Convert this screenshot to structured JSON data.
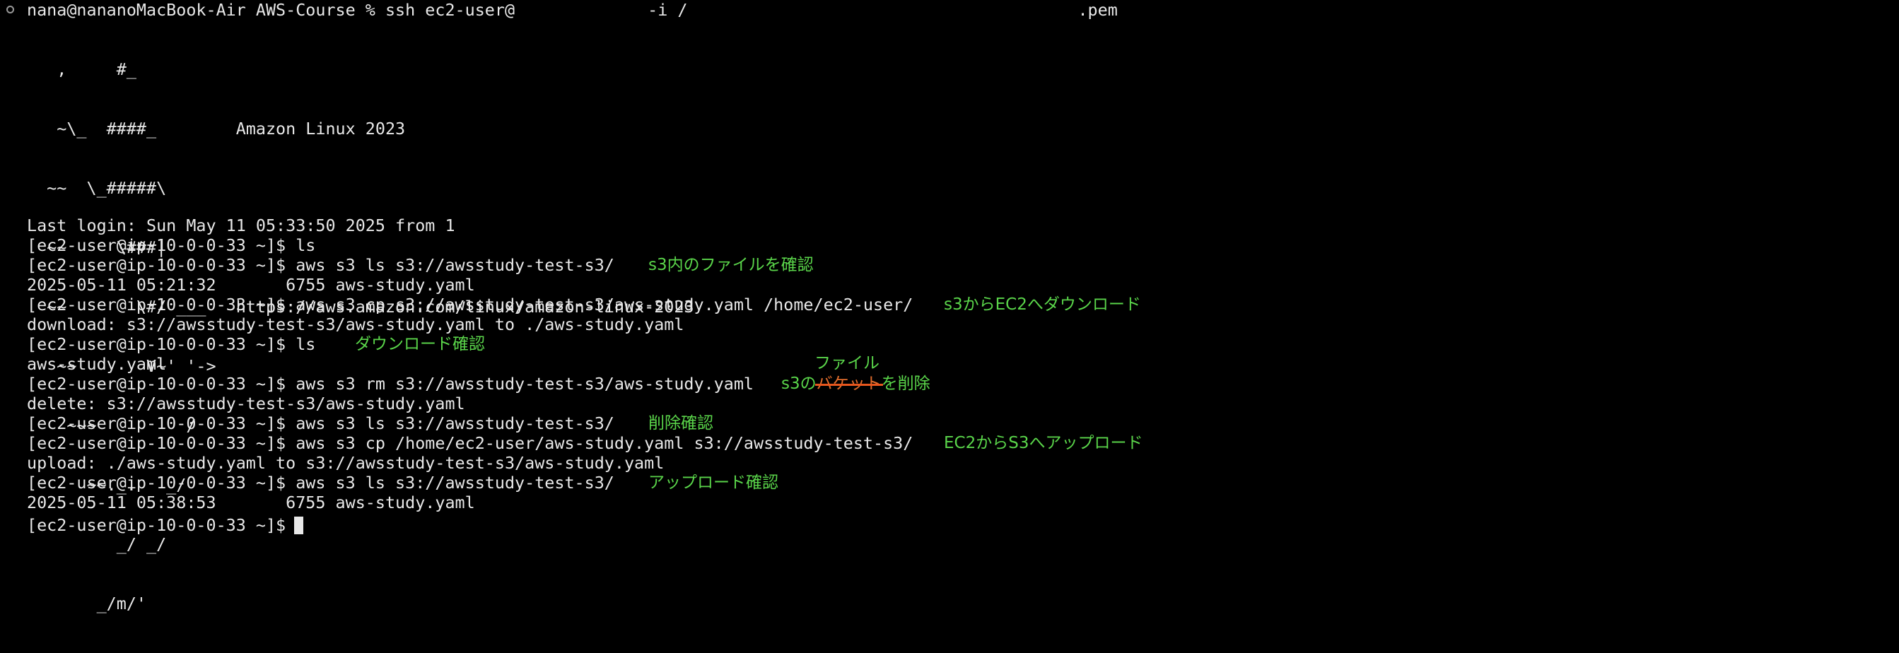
{
  "terminal": {
    "first_command": "nana@nananoMacBook-Air AWS-Course % ssh ec2-user@",
    "first_command_middle": " -i /",
    "first_command_end": ".pem",
    "banner": {
      "art_lines": [
        "   ,     #_",
        "   ~\\_  ####_        Amazon Linux 2023",
        "  ~~  \\_#####\\",
        "  ~~     \\###|",
        "  ~~       \\#/ ___   https://aws.amazon.com/linux/amazon-linux-2023",
        "   ~~       V~' '->",
        "    ~~~         /",
        "      ~~._.   _/",
        "         _/ _/",
        "       _/m/'"
      ]
    },
    "last_login": "Last login: Sun May 11 05:33:50 2025 from 1",
    "lines": [
      "[ec2-user@ip-10-0-0-33 ~]$ ls",
      "[ec2-user@ip-10-0-0-33 ~]$ aws s3 ls s3://awsstudy-test-s3/",
      "2025-05-11 05:21:32       6755 aws-study.yaml",
      "[ec2-user@ip-10-0-0-33 ~]$ aws s3 cp s3://awsstudy-test-s3/aws-study.yaml /home/ec2-user/",
      "download: s3://awsstudy-test-s3/aws-study.yaml to ./aws-study.yaml",
      "[ec2-user@ip-10-0-0-33 ~]$ ls",
      "aws-study.yaml",
      "[ec2-user@ip-10-0-0-33 ~]$ aws s3 rm s3://awsstudy-test-s3/aws-study.yaml",
      "delete: s3://awsstudy-test-s3/aws-study.yaml",
      "[ec2-user@ip-10-0-0-33 ~]$ aws s3 ls s3://awsstudy-test-s3/",
      "[ec2-user@ip-10-0-0-33 ~]$ aws s3 cp /home/ec2-user/aws-study.yaml s3://awsstudy-test-s3/",
      "upload: ./aws-study.yaml to s3://awsstudy-test-s3/aws-study.yaml",
      "[ec2-user@ip-10-0-0-33 ~]$ aws s3 ls s3://awsstudy-test-s3/",
      "2025-05-11 05:38:53       6755 aws-study.yaml",
      "[ec2-user@ip-10-0-0-33 ~]$ "
    ]
  },
  "annotations": {
    "s3_list": "s3内のファイルを確認",
    "download": "s3からEC2へダウンロード",
    "download_check": "ダウンロード確認",
    "rm_prefix": "s3の",
    "rm_struck": "バケット",
    "rm_suffix": "を削除",
    "rm_correction": "ファイル",
    "delete_check": "削除確認",
    "upload": "EC2からS3へアップロード",
    "upload_check": "アップロード確認"
  },
  "colors": {
    "background": "#000000",
    "text": "#e8e8e8",
    "annotation": "#5ad54a",
    "strike": "#e8571e"
  }
}
